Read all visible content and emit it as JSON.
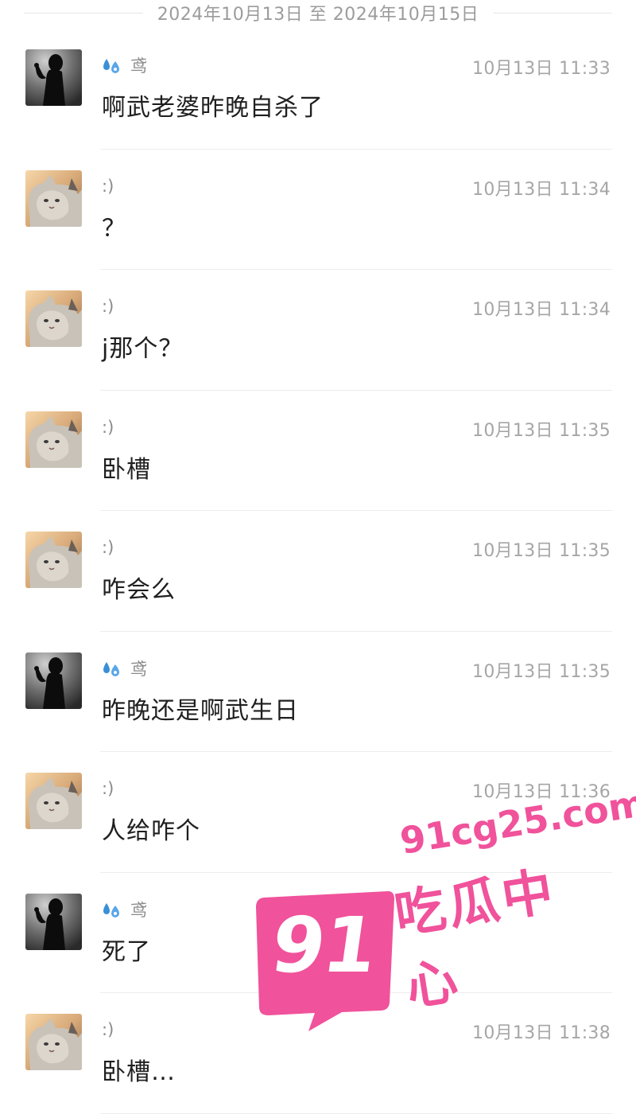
{
  "date_range": "2024年10月13日 至 2024年10月15日",
  "messages": [
    {
      "sender": "鸢",
      "avatar": "silhouette-avatar",
      "badge": true,
      "time": "10月13日 11:33",
      "text": "啊武老婆昨晚自杀了"
    },
    {
      "sender": ":)",
      "avatar": "cat-avatar",
      "badge": false,
      "time": "10月13日 11:34",
      "text": "？"
    },
    {
      "sender": ":)",
      "avatar": "cat-avatar",
      "badge": false,
      "time": "10月13日 11:34",
      "text": "j那个？"
    },
    {
      "sender": ":)",
      "avatar": "cat-avatar",
      "badge": false,
      "time": "10月13日 11:35",
      "text": "卧槽"
    },
    {
      "sender": ":)",
      "avatar": "cat-avatar",
      "badge": false,
      "time": "10月13日 11:35",
      "text": "咋会么"
    },
    {
      "sender": "鸢",
      "avatar": "silhouette-avatar",
      "badge": true,
      "time": "10月13日 11:35",
      "text": "昨晚还是啊武生日"
    },
    {
      "sender": ":)",
      "avatar": "cat-avatar",
      "badge": false,
      "time": "10月13日 11:36",
      "text": "人给咋个"
    },
    {
      "sender": "鸢",
      "avatar": "silhouette-avatar",
      "badge": true,
      "time": "",
      "text": "死了"
    },
    {
      "sender": ":)",
      "avatar": "cat-avatar",
      "badge": false,
      "time": "10月13日 11:38",
      "text": "卧槽…"
    }
  ],
  "watermark": {
    "number": "91",
    "domain": "91cg25.com",
    "brand": "吃瓜中心",
    "color": "#f0529b"
  }
}
